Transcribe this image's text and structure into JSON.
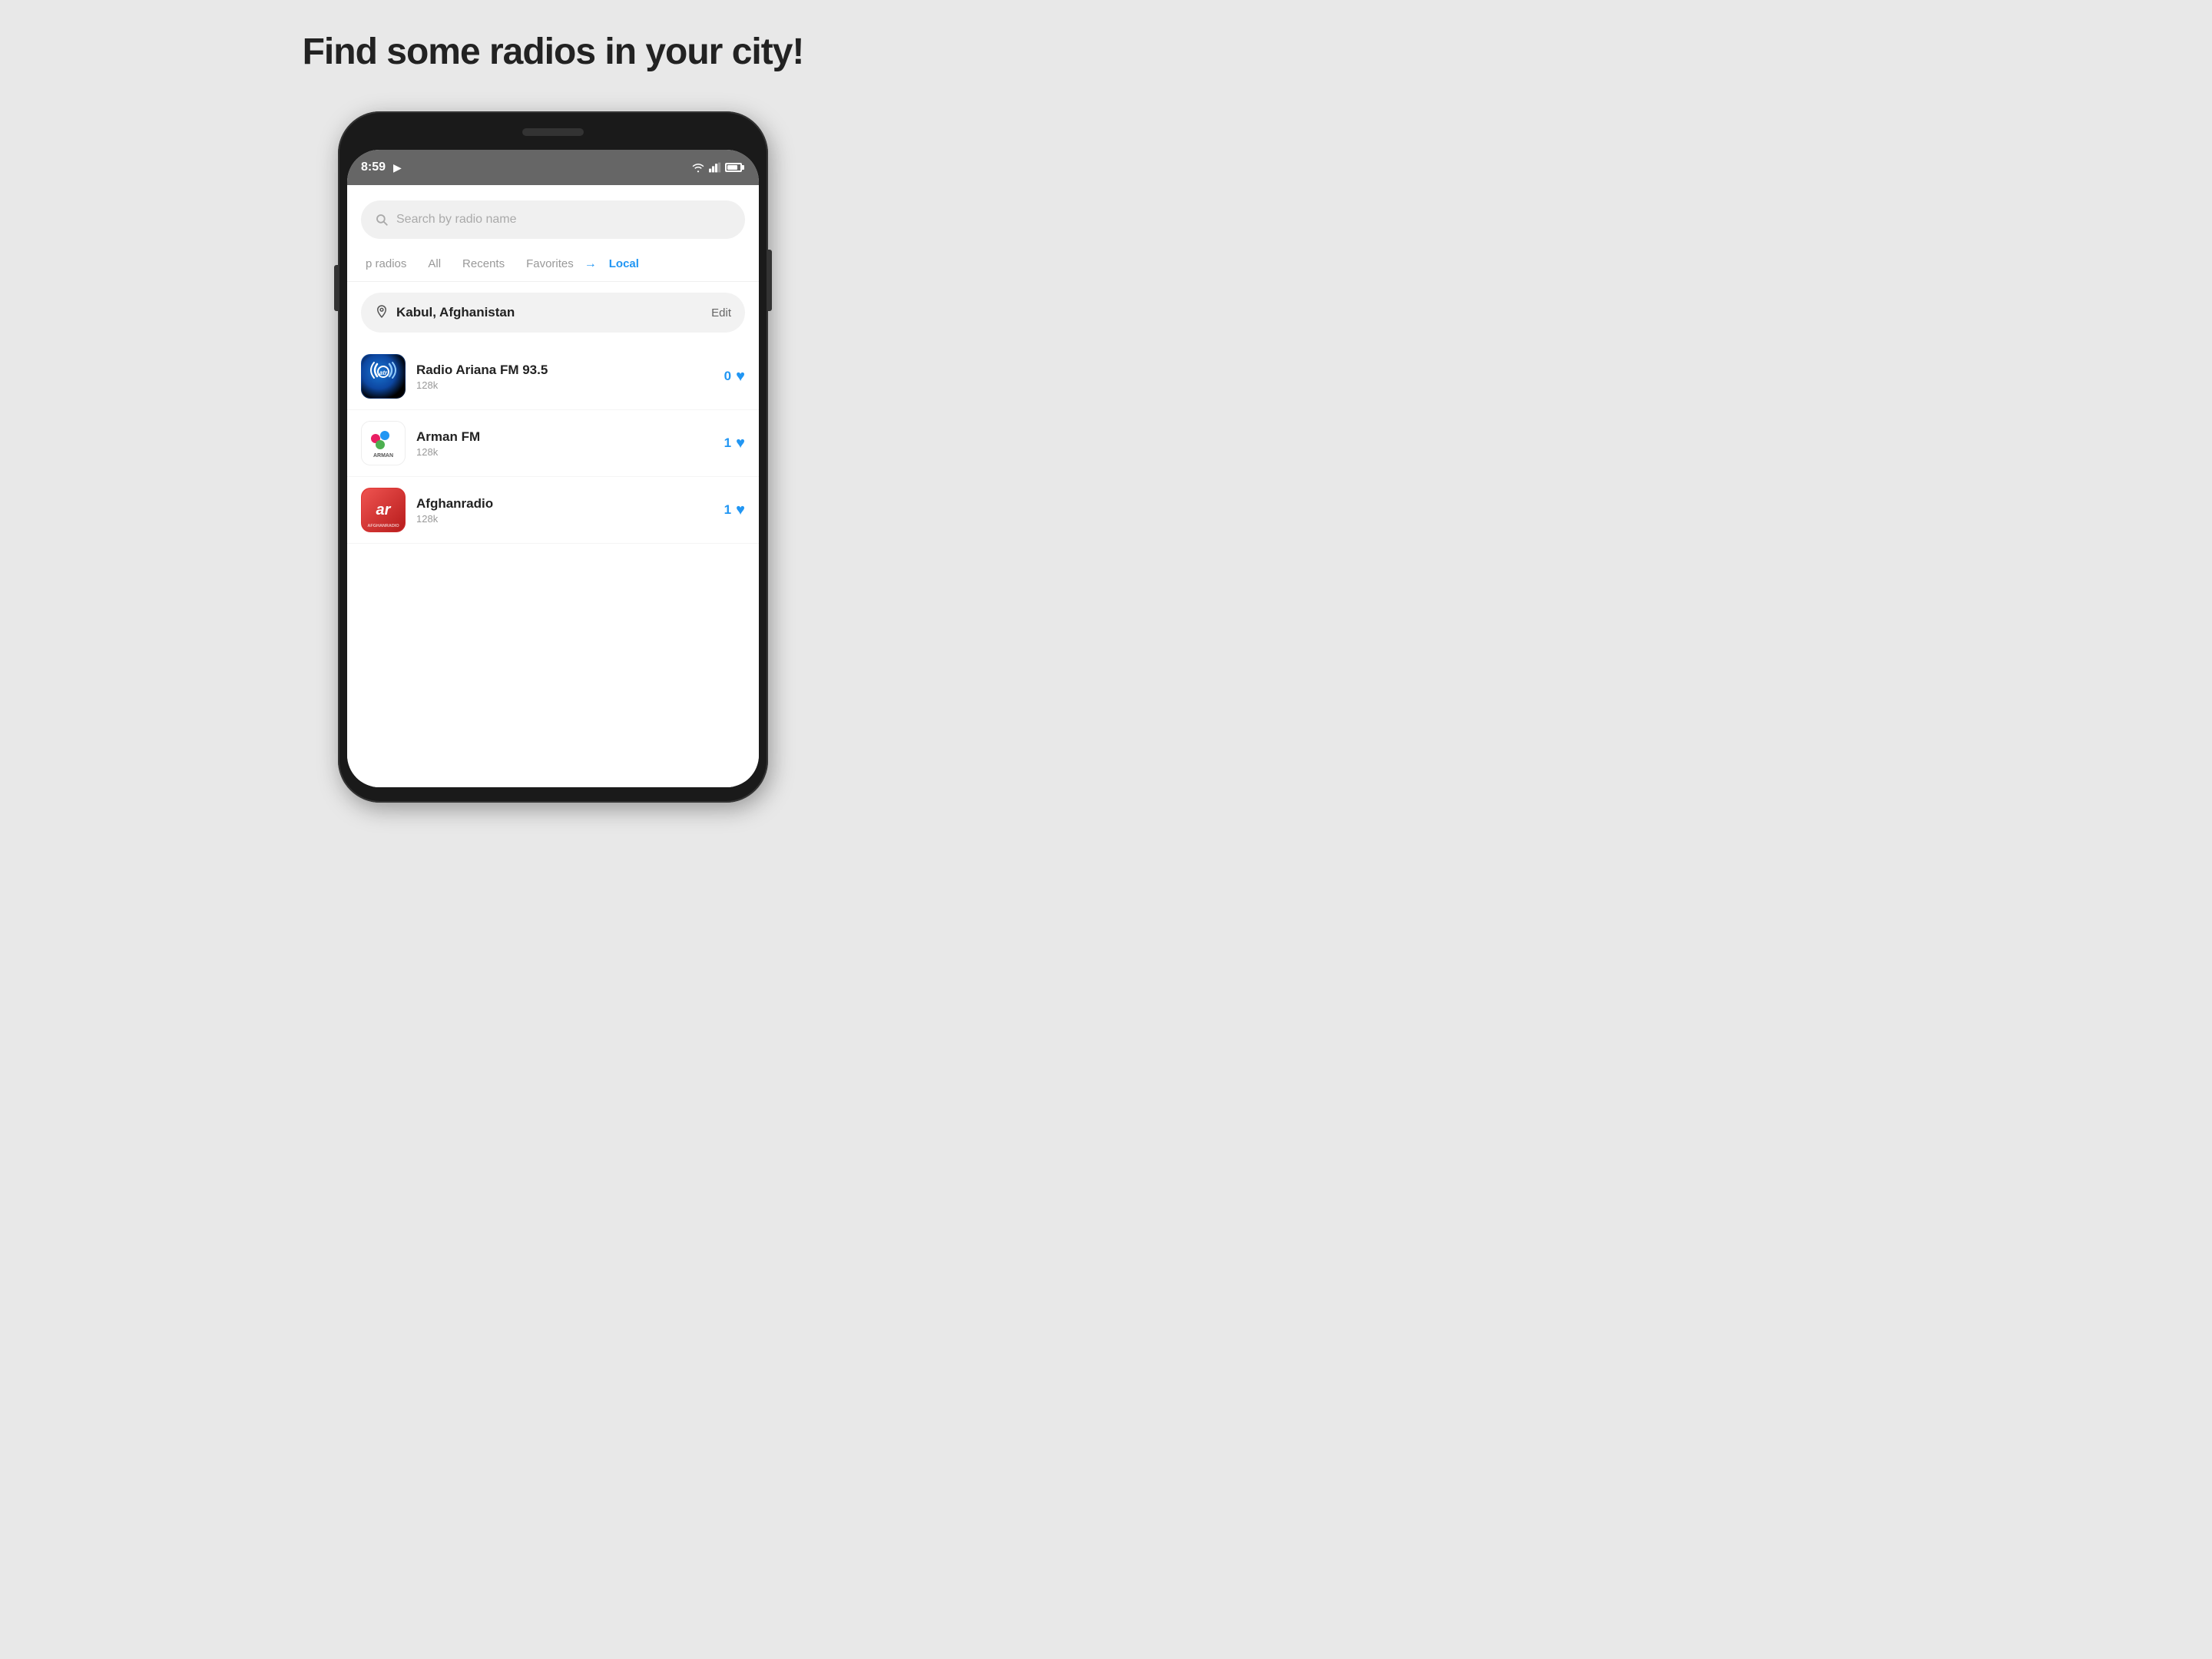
{
  "page": {
    "title": "Find some radios in your city!",
    "background_color": "#e8e8e8"
  },
  "status_bar": {
    "time": "8:59",
    "has_play": true
  },
  "search": {
    "placeholder": "Search by radio name"
  },
  "tabs": [
    {
      "label": "p radios",
      "active": false
    },
    {
      "label": "All",
      "active": false
    },
    {
      "label": "Recents",
      "active": false
    },
    {
      "label": "Favorites",
      "active": false
    },
    {
      "label": "Local",
      "active": true
    }
  ],
  "location": {
    "city": "Kabul, Afghanistan",
    "edit_label": "Edit"
  },
  "radio_list": [
    {
      "name": "Radio Ariana FM 93.5",
      "bitrate": "128k",
      "likes": "0",
      "logo_type": "atr"
    },
    {
      "name": "Arman FM",
      "bitrate": "128k",
      "likes": "1",
      "logo_type": "arman"
    },
    {
      "name": "Afghanradio",
      "bitrate": "128k",
      "likes": "1",
      "logo_type": "afghan"
    }
  ]
}
